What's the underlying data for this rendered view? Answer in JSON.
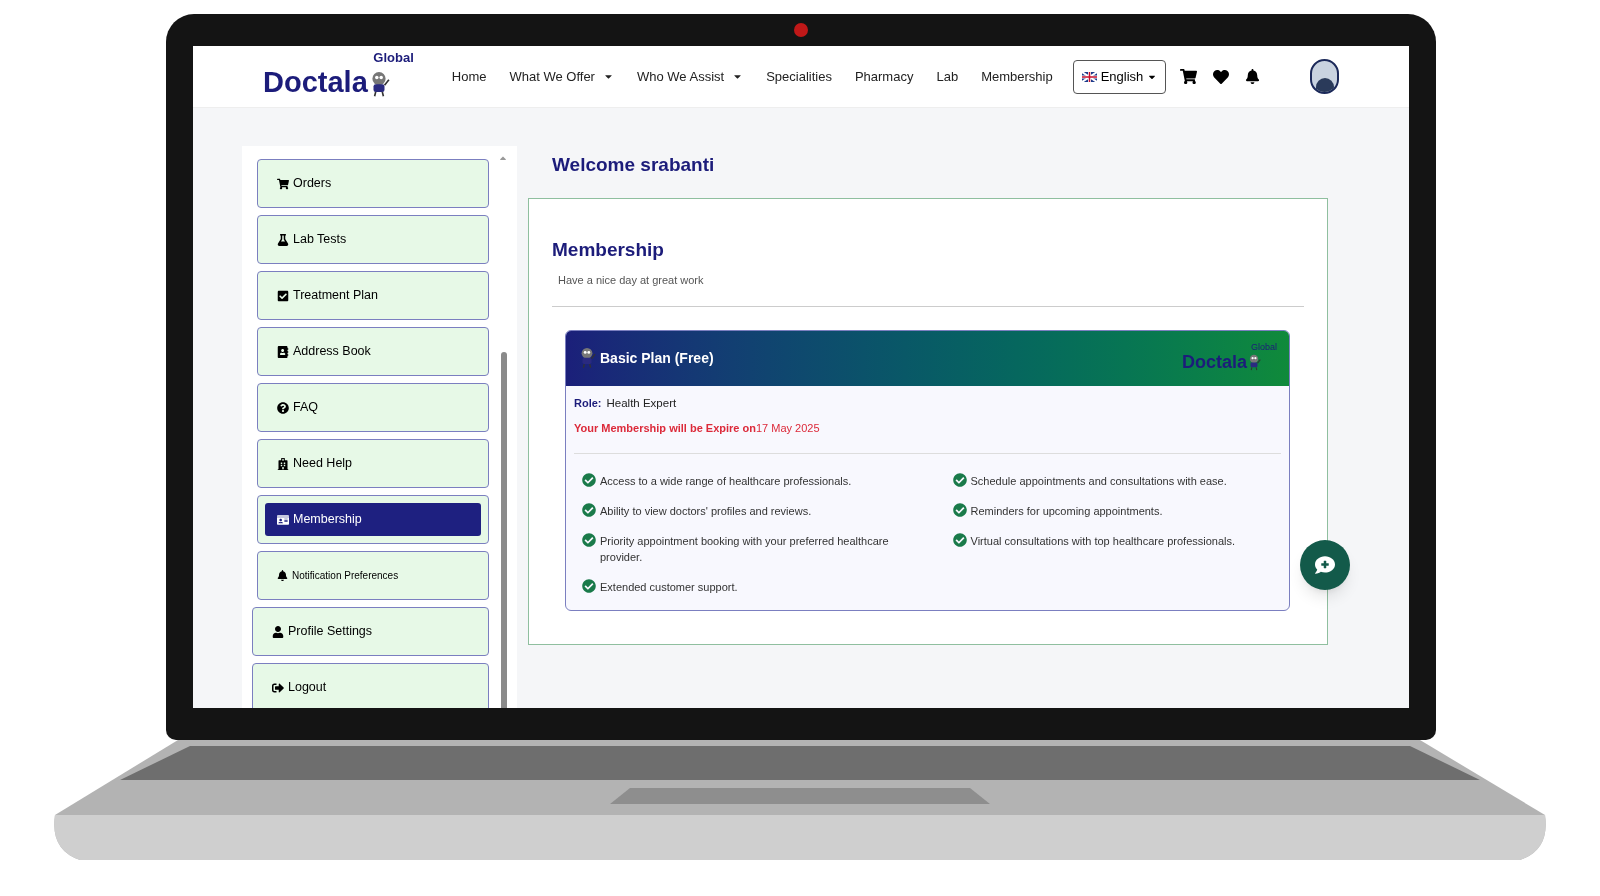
{
  "header": {
    "logo": {
      "name": "Doctala",
      "tag": "Global"
    },
    "nav": [
      {
        "label": "Home",
        "has_dropdown": false
      },
      {
        "label": "What We Offer",
        "has_dropdown": true
      },
      {
        "label": "Who We Assist",
        "has_dropdown": true
      },
      {
        "label": "Specialities",
        "has_dropdown": false
      },
      {
        "label": "Pharmacy",
        "has_dropdown": false
      },
      {
        "label": "Lab",
        "has_dropdown": false
      },
      {
        "label": "Membership",
        "has_dropdown": false
      }
    ],
    "language": "English"
  },
  "sidebar": {
    "items": [
      {
        "label": "Orders",
        "selected": false
      },
      {
        "label": "Lab Tests",
        "selected": false
      },
      {
        "label": "Treatment Plan",
        "selected": false
      },
      {
        "label": "Address Book",
        "selected": false
      },
      {
        "label": "FAQ",
        "selected": false
      },
      {
        "label": "Need Help",
        "selected": false
      },
      {
        "label": "Membership",
        "selected": true
      },
      {
        "label": "Notification Preferences",
        "selected": false
      },
      {
        "label": "Profile Settings",
        "selected": false
      },
      {
        "label": "Logout",
        "selected": false
      }
    ]
  },
  "welcome": "Welcome srabanti",
  "section": {
    "title": "Membership",
    "subtitle": "Have a nice day at great work"
  },
  "plan": {
    "title": "Basic Plan (Free)",
    "logo": {
      "name": "Doctala",
      "tag": "Global"
    },
    "role_label": "Role:",
    "role": "Health Expert",
    "expiry_label": "Your Membership will be Expire on",
    "expiry_date": "17 May 2025",
    "features": [
      "Access to a wide range of healthcare professionals.",
      "Schedule appointments and consultations with ease.",
      "Ability to view doctors' profiles and reviews.",
      "Reminders for upcoming appointments.",
      "Priority appointment booking with your preferred healthcare provider.",
      "Virtual consultations with top healthcare professionals.",
      "Extended customer support."
    ]
  }
}
